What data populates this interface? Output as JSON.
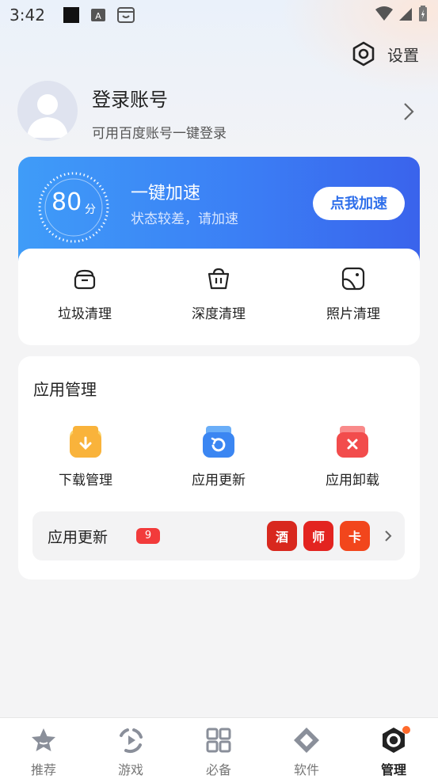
{
  "status_bar": {
    "time": "3:42"
  },
  "header": {
    "settings_label": "设置"
  },
  "account": {
    "title": "登录账号",
    "subtitle": "可用百度账号一键登录"
  },
  "boost": {
    "score": "80",
    "score_unit": "分",
    "title": "一键加速",
    "subtitle": "状态较差，请加速",
    "button_label": "点我加速"
  },
  "cleaning": {
    "items": [
      {
        "label": "垃圾清理",
        "icon": "trash-can-icon"
      },
      {
        "label": "深度清理",
        "icon": "basket-icon"
      },
      {
        "label": "照片清理",
        "icon": "photo-icon"
      }
    ]
  },
  "app_management": {
    "title": "应用管理",
    "items": [
      {
        "label": "下载管理",
        "icon": "download-icon",
        "color": "#f9b33b"
      },
      {
        "label": "应用更新",
        "icon": "update-icon",
        "color": "#3b86f2"
      },
      {
        "label": "应用卸载",
        "icon": "uninstall-icon",
        "color": "#f24c4c"
      }
    ],
    "update_row": {
      "label": "应用更新",
      "badge": "9",
      "apps": [
        {
          "text": "酒",
          "color": "#d8281e"
        },
        {
          "text": "师",
          "color": "#e32420"
        },
        {
          "text": "卡",
          "color": "#f2461c"
        }
      ]
    }
  },
  "bottom_nav": {
    "items": [
      {
        "label": "推荐",
        "icon": "star-icon"
      },
      {
        "label": "游戏",
        "icon": "gamepad-icon"
      },
      {
        "label": "必备",
        "icon": "grid-icon"
      },
      {
        "label": "软件",
        "icon": "diamond-icon"
      },
      {
        "label": "管理",
        "icon": "manage-icon"
      }
    ],
    "active": "管理"
  }
}
